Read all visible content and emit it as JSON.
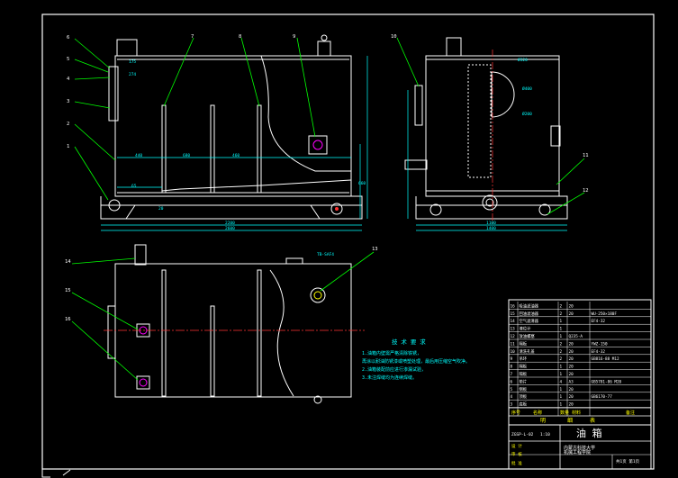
{
  "colors": {
    "background": "#000000",
    "frame": "#ffffff",
    "leader": "#00ff00",
    "dimension": "#00ffff",
    "centerline": "#ff3333",
    "accent": "#ffff00",
    "magenta": "#ff00ff"
  },
  "callouts": [
    "1",
    "2",
    "3",
    "4",
    "5",
    "6",
    "7",
    "8",
    "9",
    "10",
    "11",
    "12",
    "13",
    "14",
    "15",
    "16"
  ],
  "front_view": {
    "dims_inner": [
      "440",
      "680",
      "460"
    ],
    "dims_outer": [
      "2200",
      "2600"
    ],
    "small_dims": [
      "175",
      "274",
      "65",
      "20",
      "660"
    ]
  },
  "side_view": {
    "dims": [
      "1100",
      "1400"
    ],
    "circle_labels": [
      "Ø400",
      "Ø200",
      "Ø320"
    ]
  },
  "top_view": {
    "dim_label": "TB-SAF4",
    "notes_title": "技 术 要 求",
    "notes": [
      "1.油箱内壁需严格清除铁锈，",
      "  再涂以耐油防锈漆或喷塑处理，最后用压缩空气吹净。",
      "2.油箱装配前应进行渗漏试验，",
      "3.未注焊缝均为连续焊缝。"
    ]
  },
  "title_block": {
    "parts_rows": [
      {
        "no": "16",
        "name": "吸油滤油器",
        "qty": "2",
        "mat": "20",
        "note": ""
      },
      {
        "no": "15",
        "name": "回油滤油器",
        "qty": "2",
        "mat": "20",
        "note": "WU-250×180F"
      },
      {
        "no": "14",
        "name": "空气滤清器",
        "qty": "1",
        "mat": "",
        "note": "EF4-32"
      },
      {
        "no": "13",
        "name": "液位计",
        "qty": "1",
        "mat": "",
        "note": ""
      },
      {
        "no": "12",
        "name": "放油螺塞",
        "qty": "1",
        "mat": "Q235-A",
        "note": ""
      },
      {
        "no": "11",
        "name": "隔板",
        "qty": "2",
        "mat": "20",
        "note": "YWZ-150"
      },
      {
        "no": "10",
        "name": "清洗孔盖",
        "qty": "2",
        "mat": "20",
        "note": "EF4-32"
      },
      {
        "no": "9",
        "name": "吊环",
        "qty": "2",
        "mat": "20",
        "note": "GB816-88 M12"
      },
      {
        "no": "8",
        "name": "隔板",
        "qty": "1",
        "mat": "20",
        "note": ""
      },
      {
        "no": "7",
        "name": "隔板",
        "qty": "1",
        "mat": "20",
        "note": ""
      },
      {
        "no": "6",
        "name": "垫片",
        "qty": "4",
        "mat": "A3",
        "note": "GB5781-86 M20"
      },
      {
        "no": "5",
        "name": "侧板",
        "qty": "1",
        "mat": "20",
        "note": ""
      },
      {
        "no": "4",
        "name": "顶板",
        "qty": "1",
        "mat": "20",
        "note": "GB6170-77"
      },
      {
        "no": "3",
        "name": "底板",
        "qty": "1",
        "mat": "20",
        "note": ""
      }
    ],
    "header_cols": [
      "序号",
      "名称",
      "数量",
      "材料",
      "备注"
    ],
    "sub_header": [
      "明",
      "细",
      "表"
    ],
    "title": "油     箱",
    "school_line1": "内蒙古科技大学",
    "school_line2": "机械工程学院",
    "ref": "ZGSP-L-02",
    "scale": "1:10",
    "sheet": "共1页 第1页",
    "sign_labels": [
      "设 计",
      "审 核",
      "批 准"
    ]
  }
}
